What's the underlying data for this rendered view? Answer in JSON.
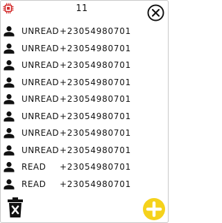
{
  "header": {
    "count": "11",
    "app_icon": "chip-icon",
    "close_icon": "close-circle-icon",
    "accent_color": "#d22b2b"
  },
  "messages": [
    {
      "status": "UNREAD",
      "phone": "+23054980701",
      "icon": "person-icon"
    },
    {
      "status": "UNREAD",
      "phone": "+23054980701",
      "icon": "person-icon"
    },
    {
      "status": "UNREAD",
      "phone": "+23054980701",
      "icon": "person-icon"
    },
    {
      "status": "UNREAD",
      "phone": "+23054980701",
      "icon": "person-icon"
    },
    {
      "status": "UNREAD",
      "phone": "+23054980701",
      "icon": "person-icon"
    },
    {
      "status": "UNREAD",
      "phone": "+23054980701",
      "icon": "person-icon"
    },
    {
      "status": "UNREAD",
      "phone": "+23054980701",
      "icon": "person-icon"
    },
    {
      "status": "UNREAD",
      "phone": "+23054980701",
      "icon": "person-icon"
    },
    {
      "status": "READ",
      "phone": "+23054980701",
      "icon": "person-icon"
    },
    {
      "status": "READ",
      "phone": "+23054980701",
      "icon": "person-icon"
    }
  ],
  "footer": {
    "delete_icon": "trash-icon",
    "add_icon": "plus-icon",
    "add_button_color": "#f5d21c"
  }
}
